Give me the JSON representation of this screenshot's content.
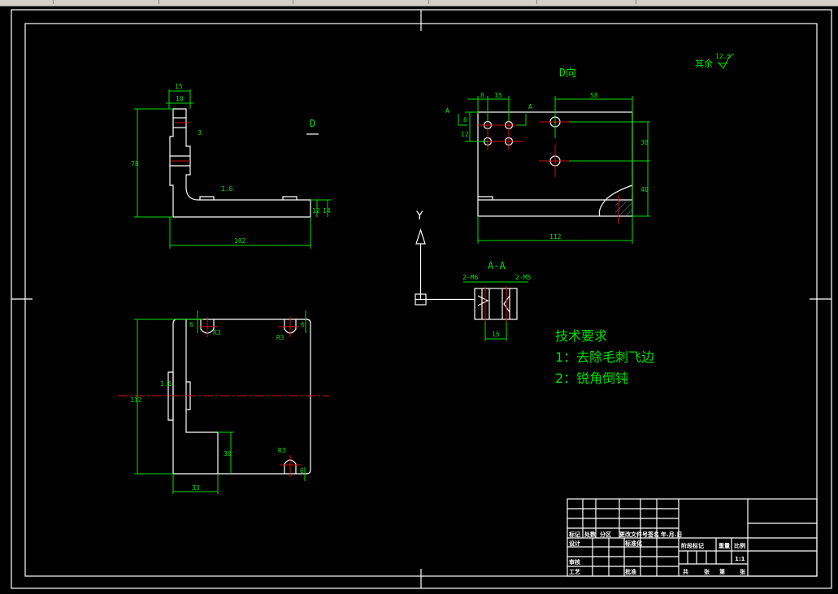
{
  "app": {
    "background": "#000000",
    "line_color": "#ffffff",
    "dimension_color": "#00e000",
    "centerline_color": "#d01010",
    "hatch_color": "#40c0d0"
  },
  "views": {
    "side_view": {
      "marker": "D",
      "dims": [
        "15",
        "10",
        "78",
        "102",
        "12",
        "14",
        "3"
      ],
      "roughness": "1.6"
    },
    "d_view": {
      "title": "D向",
      "section_mark": "A",
      "dims": [
        "8",
        "15",
        "58",
        "6",
        "12",
        "38",
        "40",
        "112"
      ]
    },
    "bottom_view": {
      "dims": [
        "112",
        "33",
        "30",
        "6",
        "6",
        "6"
      ],
      "roughness": "1.6",
      "radius": "R3"
    },
    "section": {
      "title": "A-A",
      "left_label": "2-M6",
      "right_label": "2-M5",
      "dim": "15"
    },
    "ucs": {
      "axis_label": "Y"
    },
    "roughness_note": {
      "label": "其余",
      "value": "12.5"
    }
  },
  "tech_requirements": {
    "title": "技术要求",
    "items": [
      "1：去除毛刺飞边",
      "2：锐角倒钝"
    ]
  },
  "title_block": {
    "header_row": [
      "标记",
      "处数",
      "分区",
      "更改文件号",
      "签名",
      "年.月.日"
    ],
    "design": "设计",
    "standardize": "标准化",
    "review": "审核",
    "process": "工艺",
    "approve": "批准",
    "stage_mark": "阶段标记",
    "weight": "重量",
    "scale_label": "比例",
    "scale": "1:1",
    "sheets": [
      "共",
      "张",
      "第",
      "张"
    ]
  }
}
